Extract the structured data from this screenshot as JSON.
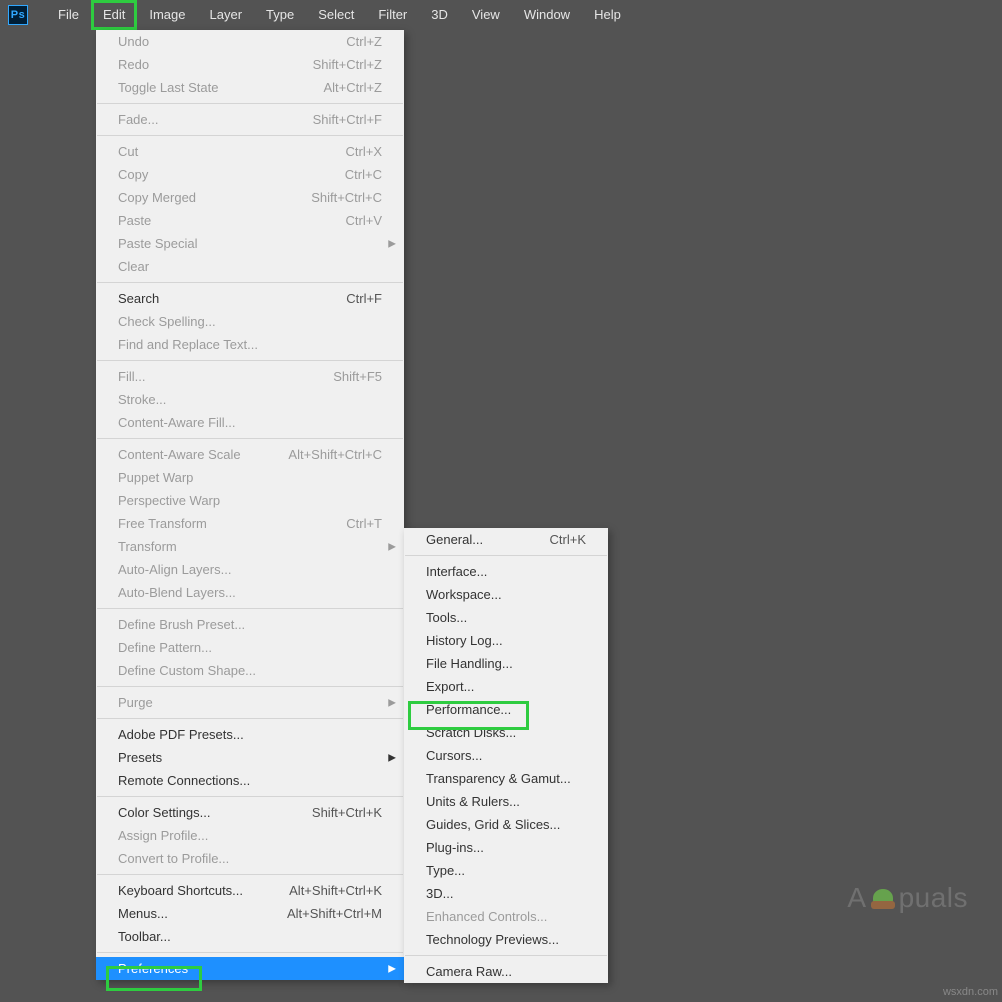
{
  "logo": "Ps",
  "menubar": [
    "File",
    "Edit",
    "Image",
    "Layer",
    "Type",
    "Select",
    "Filter",
    "3D",
    "View",
    "Window",
    "Help"
  ],
  "edit_menu": {
    "groups": [
      [
        {
          "label": "Undo",
          "shortcut": "Ctrl+Z",
          "disabled": true
        },
        {
          "label": "Redo",
          "shortcut": "Shift+Ctrl+Z",
          "disabled": true
        },
        {
          "label": "Toggle Last State",
          "shortcut": "Alt+Ctrl+Z",
          "disabled": true
        }
      ],
      [
        {
          "label": "Fade...",
          "shortcut": "Shift+Ctrl+F",
          "disabled": true
        }
      ],
      [
        {
          "label": "Cut",
          "shortcut": "Ctrl+X",
          "disabled": true
        },
        {
          "label": "Copy",
          "shortcut": "Ctrl+C",
          "disabled": true
        },
        {
          "label": "Copy Merged",
          "shortcut": "Shift+Ctrl+C",
          "disabled": true
        },
        {
          "label": "Paste",
          "shortcut": "Ctrl+V",
          "disabled": true
        },
        {
          "label": "Paste Special",
          "submenu": true,
          "disabled": true
        },
        {
          "label": "Clear",
          "disabled": true
        }
      ],
      [
        {
          "label": "Search",
          "shortcut": "Ctrl+F"
        },
        {
          "label": "Check Spelling...",
          "disabled": true
        },
        {
          "label": "Find and Replace Text...",
          "disabled": true
        }
      ],
      [
        {
          "label": "Fill...",
          "shortcut": "Shift+F5",
          "disabled": true
        },
        {
          "label": "Stroke...",
          "disabled": true
        },
        {
          "label": "Content-Aware Fill...",
          "disabled": true
        }
      ],
      [
        {
          "label": "Content-Aware Scale",
          "shortcut": "Alt+Shift+Ctrl+C",
          "disabled": true
        },
        {
          "label": "Puppet Warp",
          "disabled": true
        },
        {
          "label": "Perspective Warp",
          "disabled": true
        },
        {
          "label": "Free Transform",
          "shortcut": "Ctrl+T",
          "disabled": true
        },
        {
          "label": "Transform",
          "submenu": true,
          "disabled": true
        },
        {
          "label": "Auto-Align Layers...",
          "disabled": true
        },
        {
          "label": "Auto-Blend Layers...",
          "disabled": true
        }
      ],
      [
        {
          "label": "Define Brush Preset...",
          "disabled": true
        },
        {
          "label": "Define Pattern...",
          "disabled": true
        },
        {
          "label": "Define Custom Shape...",
          "disabled": true
        }
      ],
      [
        {
          "label": "Purge",
          "submenu": true,
          "disabled": true
        }
      ],
      [
        {
          "label": "Adobe PDF Presets..."
        },
        {
          "label": "Presets",
          "submenu": true
        },
        {
          "label": "Remote Connections..."
        }
      ],
      [
        {
          "label": "Color Settings...",
          "shortcut": "Shift+Ctrl+K"
        },
        {
          "label": "Assign Profile...",
          "disabled": true
        },
        {
          "label": "Convert to Profile...",
          "disabled": true
        }
      ],
      [
        {
          "label": "Keyboard Shortcuts...",
          "shortcut": "Alt+Shift+Ctrl+K"
        },
        {
          "label": "Menus...",
          "shortcut": "Alt+Shift+Ctrl+M"
        },
        {
          "label": "Toolbar..."
        }
      ],
      [
        {
          "label": "Preferences",
          "submenu": true,
          "selected": true
        }
      ]
    ]
  },
  "pref_menu": {
    "groups": [
      [
        {
          "label": "General...",
          "shortcut": "Ctrl+K"
        }
      ],
      [
        {
          "label": "Interface..."
        },
        {
          "label": "Workspace..."
        },
        {
          "label": "Tools..."
        },
        {
          "label": "History Log..."
        },
        {
          "label": "File Handling..."
        },
        {
          "label": "Export..."
        },
        {
          "label": "Performance..."
        },
        {
          "label": "Scratch Disks..."
        },
        {
          "label": "Cursors..."
        },
        {
          "label": "Transparency & Gamut..."
        },
        {
          "label": "Units & Rulers..."
        },
        {
          "label": "Guides, Grid & Slices..."
        },
        {
          "label": "Plug-ins..."
        },
        {
          "label": "Type..."
        },
        {
          "label": "3D..."
        },
        {
          "label": "Enhanced Controls...",
          "disabled": true
        },
        {
          "label": "Technology Previews..."
        }
      ],
      [
        {
          "label": "Camera Raw..."
        }
      ]
    ]
  },
  "watermark": {
    "pre": "A",
    "post": "puals"
  },
  "source": "wsxdn.com"
}
